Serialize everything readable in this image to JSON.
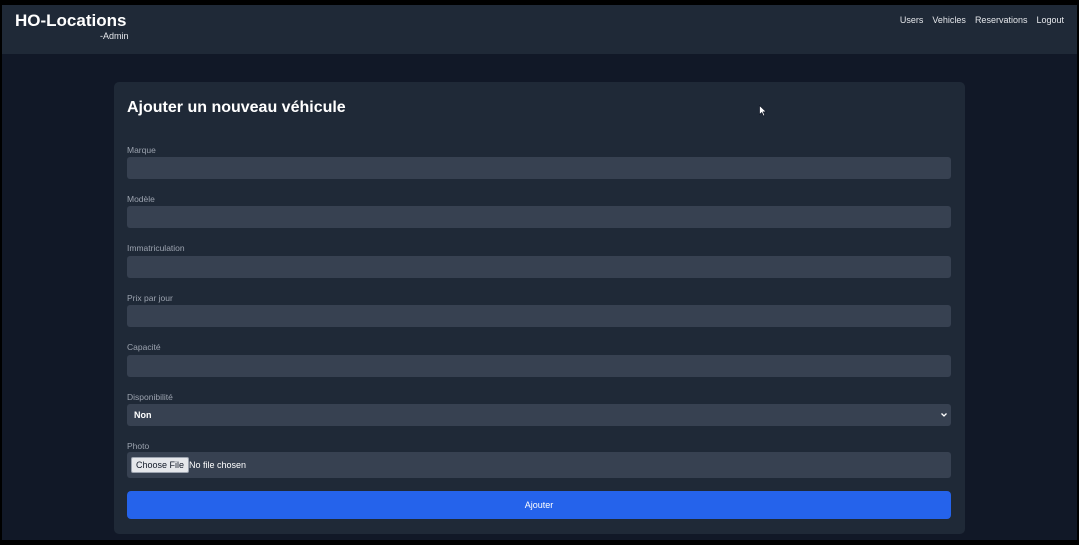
{
  "navbar": {
    "brand": "HO-Locations",
    "subtitle": "-Admin",
    "links": [
      "Users",
      "Vehicles",
      "Reservations",
      "Logout"
    ]
  },
  "form": {
    "title": "Ajouter un nouveau véhicule",
    "fields": {
      "marque": {
        "label": "Marque",
        "value": ""
      },
      "modele": {
        "label": "Modèle",
        "value": ""
      },
      "immatriculation": {
        "label": "Immatriculation",
        "value": ""
      },
      "prix": {
        "label": "Prix par jour",
        "value": ""
      },
      "capacite": {
        "label": "Capacité",
        "value": ""
      },
      "disponibilite": {
        "label": "Disponibilité",
        "selected": "Non"
      },
      "photo": {
        "label": "Photo",
        "button": "Choose File",
        "status": "No file chosen"
      }
    },
    "submit_label": "Ajouter"
  },
  "colors": {
    "page_background": "#111827",
    "panel_background": "#1f2937",
    "input_background": "#374151",
    "primary_button": "#2563eb"
  },
  "icons": [
    "chevron-down-icon",
    "mouse-cursor-icon"
  ]
}
